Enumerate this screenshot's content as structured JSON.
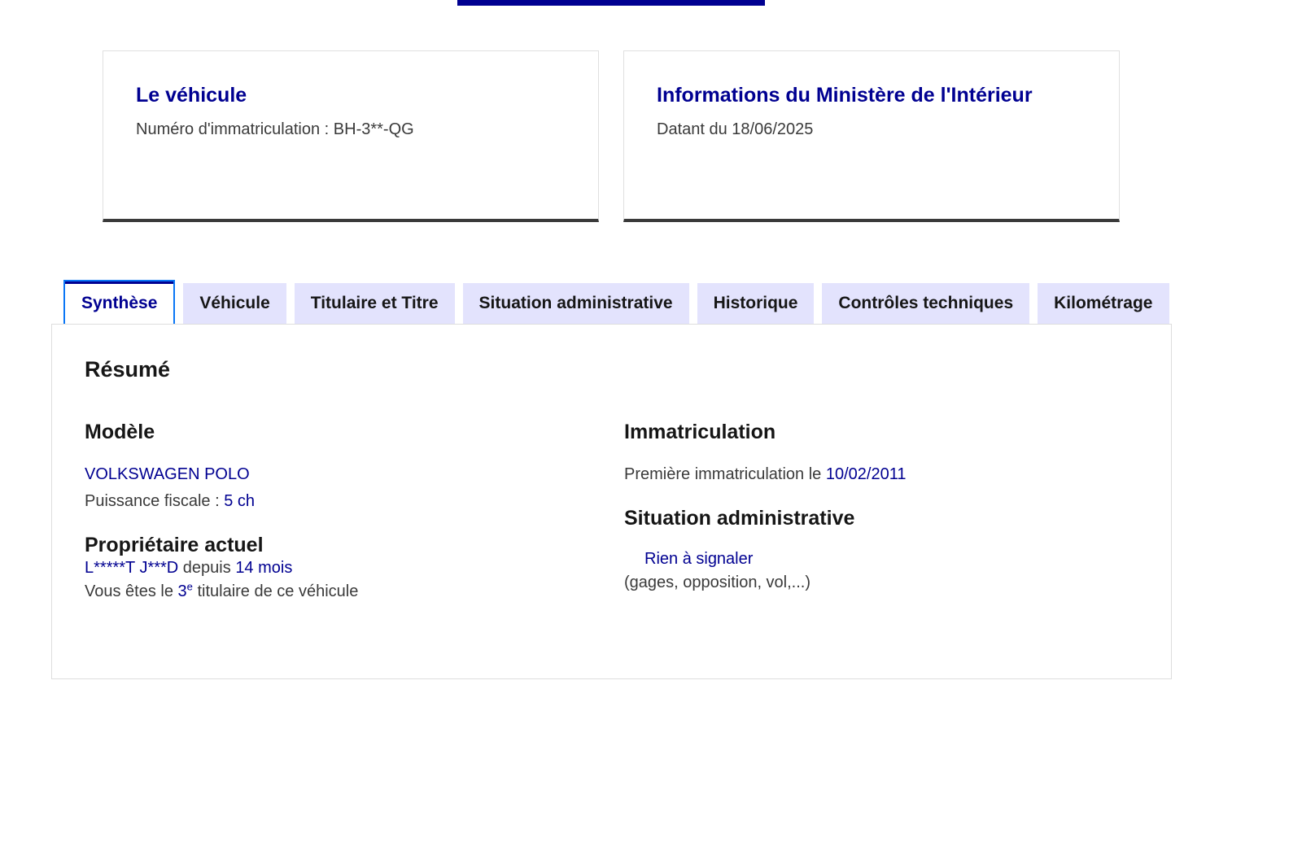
{
  "cards": {
    "vehicle": {
      "title": "Le véhicule",
      "desc": "Numéro d'immatriculation : BH-3**-QG"
    },
    "ministry": {
      "title": "Informations du Ministère de l'Intérieur",
      "desc": "Datant du 18/06/2025"
    }
  },
  "tabs": [
    {
      "label": "Synthèse",
      "active": true
    },
    {
      "label": "Véhicule"
    },
    {
      "label": "Titulaire et Titre"
    },
    {
      "label": "Situation administrative"
    },
    {
      "label": "Historique"
    },
    {
      "label": "Contrôles techniques"
    },
    {
      "label": "Kilométrage"
    }
  ],
  "summary": {
    "title": "Résumé",
    "model": {
      "heading": "Modèle",
      "name": "VOLKSWAGEN POLO",
      "power_label": "Puissance fiscale : ",
      "power_value": "5 ch"
    },
    "owner": {
      "heading": "Propriétaire actuel",
      "name": "L*****T J***D",
      "since_label": " depuis ",
      "since_value": "14 mois",
      "rank_prefix": "Vous êtes le ",
      "rank_value": "3",
      "rank_sup": "e",
      "rank_suffix": " titulaire de ce véhicule"
    },
    "registration": {
      "heading": "Immatriculation",
      "first_label": "Première immatriculation le ",
      "first_date": "10/02/2011"
    },
    "admin": {
      "heading": "Situation administrative",
      "status": "Rien à signaler",
      "details": "(gages, opposition, vol,...)"
    }
  },
  "colors": {
    "primary": "#000091",
    "tab_bg": "#e3e3fd",
    "focus": "#0a76f6",
    "card_border": "#3a3a3a"
  }
}
